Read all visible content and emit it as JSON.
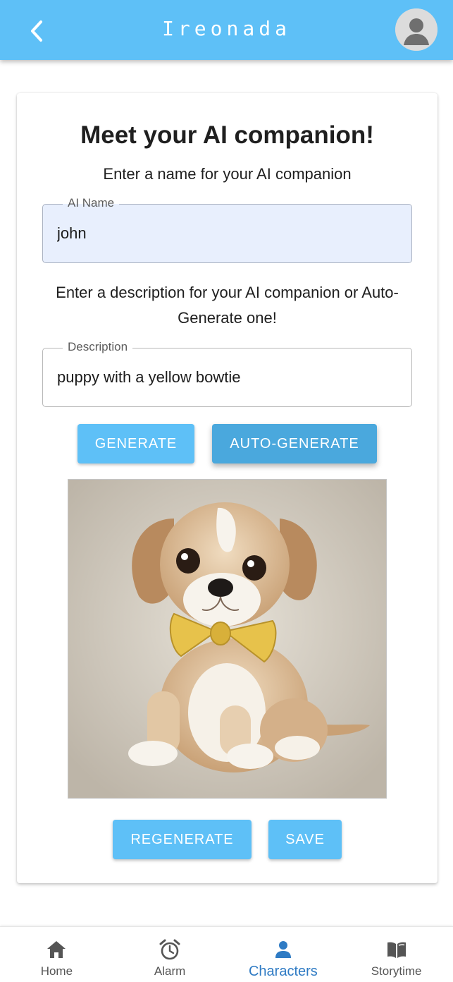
{
  "appbar": {
    "title": "Ireonada",
    "back_icon": "chevron-left-icon",
    "avatar_icon": "account-avatar-icon"
  },
  "card": {
    "heading": "Meet your AI companion!",
    "name_prompt": "Enter a name for your AI companion",
    "name_field": {
      "label": "AI Name",
      "value": "john"
    },
    "description_prompt": "Enter a description for your AI companion or Auto-Generate one!",
    "description_field": {
      "label": "Description",
      "value": "puppy with a yellow bowtie"
    },
    "generate_label": "GENERATE",
    "auto_generate_label": "AUTO-GENERATE",
    "image_subject": "puppy with yellow bowtie illustration",
    "regenerate_label": "REGENERATE",
    "save_label": "SAVE"
  },
  "bottom_nav": {
    "items": [
      {
        "label": "Home",
        "icon": "home-icon",
        "active": false
      },
      {
        "label": "Alarm",
        "icon": "alarm-clock-icon",
        "active": false
      },
      {
        "label": "Characters",
        "icon": "person-icon",
        "active": true
      },
      {
        "label": "Storytime",
        "icon": "open-book-icon",
        "active": false
      }
    ]
  },
  "colors": {
    "primary": "#5ec0f7",
    "primary_dark": "#4aa8dd",
    "active_nav": "#2f7bc4",
    "filled_input_bg": "#e8effd"
  }
}
